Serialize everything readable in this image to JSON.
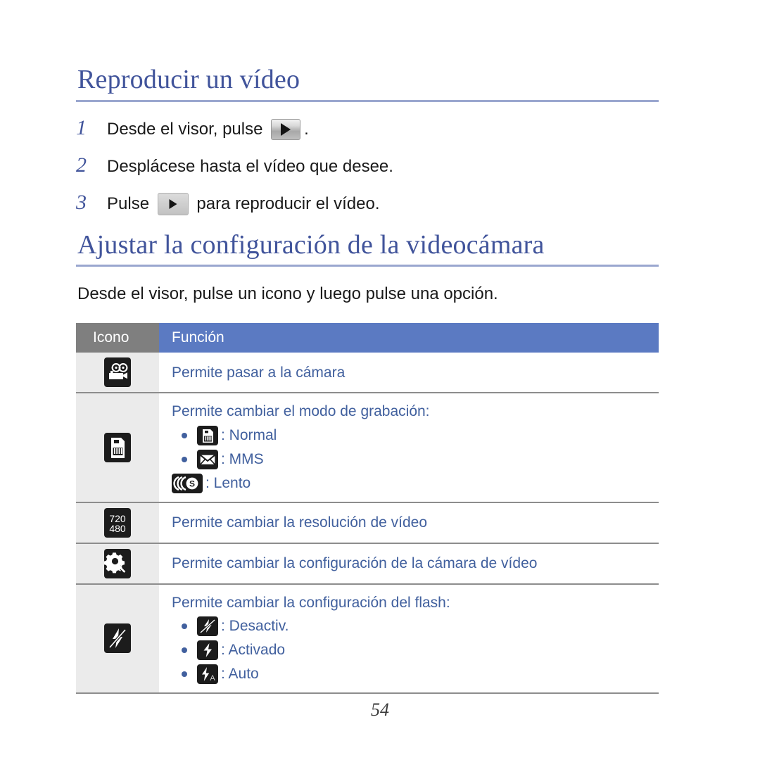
{
  "page": {
    "folio": "54"
  },
  "sections": [
    {
      "heading": "Reproducir un vídeo",
      "steps": [
        {
          "number": "1",
          "before": "Desde el visor, pulse ",
          "icon": "play-button-icon",
          "after": "."
        },
        {
          "number": "2",
          "before": "Desplácese hasta el vídeo que desee.",
          "icon": "",
          "after": ""
        },
        {
          "number": "3",
          "before": "Pulse ",
          "icon": "play-button-icon",
          "after": " para reproducir el vídeo."
        }
      ]
    },
    {
      "heading": "Ajustar la configuración de la videocámara",
      "intro": "Desde el visor, pulse un icono y luego pulse una opción."
    }
  ],
  "table": {
    "headers": {
      "icon": "Icono",
      "function": "Función"
    },
    "rows": [
      {
        "icon_name": "video-camera-icon",
        "function": "Permite pasar a la cámara",
        "options": []
      },
      {
        "icon_name": "recording-mode-card-icon",
        "function": "Permite cambiar el modo de grabación:",
        "options": [
          {
            "icon_name": "memory-card-icon",
            "label": ": Normal"
          },
          {
            "icon_name": "envelope-mms-icon",
            "label": ": MMS"
          },
          {
            "icon_name": "slow-motion-icon",
            "label": ": Lento"
          }
        ]
      },
      {
        "icon_name": "resolution-720-480-icon",
        "function": "Permite cambiar la resolución de vídeo",
        "options": []
      },
      {
        "icon_name": "gear-wrench-settings-icon",
        "function": "Permite cambiar la configuración de la cámara de vídeo",
        "options": []
      },
      {
        "icon_name": "flash-off-icon",
        "function": "Permite cambiar la configuración del flash:",
        "options": [
          {
            "icon_name": "flash-off-icon",
            "label": ": Desactiv."
          },
          {
            "icon_name": "flash-on-icon",
            "label": ": Activado"
          },
          {
            "icon_name": "flash-auto-icon",
            "label": ": Auto"
          }
        ]
      }
    ]
  },
  "icon_text": {
    "resolution_top": "720",
    "resolution_bottom": "480",
    "slow_letter": "S",
    "auto_letter": "A"
  },
  "colors": {
    "heading": "#41549b",
    "heading_rule": "#9aa7cf",
    "table_header_icon_bg": "#7f7f7f",
    "table_header_func_bg": "#5b7ac2",
    "icon_cell_bg": "#ebebeb",
    "function_text": "#41609e",
    "row_border": "#8d8d8d",
    "icon_glyph_bg": "#1c1c1c"
  }
}
